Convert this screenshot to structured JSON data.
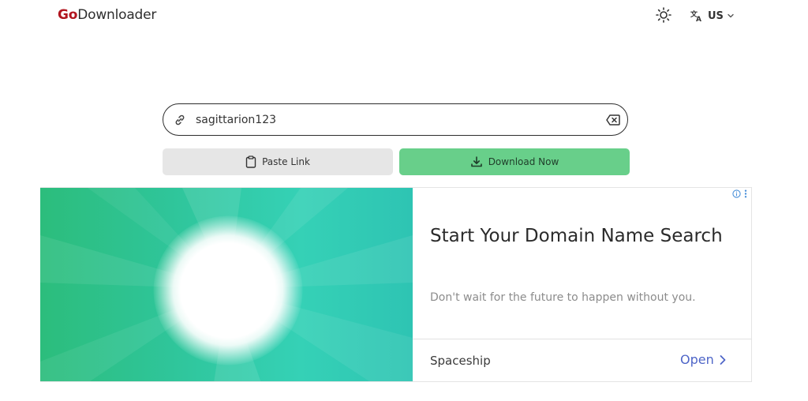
{
  "header": {
    "logo_go": "Go",
    "logo_rest": "Downloader",
    "language_code": "US",
    "icons": {
      "theme": "sun-icon",
      "language": "translate-icon",
      "dropdown": "chevron-down-icon"
    }
  },
  "search": {
    "value": "sagittarion123",
    "placeholder": "",
    "icons": {
      "left": "link-icon",
      "right": "backspace-clear-icon"
    }
  },
  "actions": {
    "paste_label": "Paste Link",
    "download_label": "Download Now"
  },
  "ad": {
    "headline": "Start Your Domain Name Search",
    "description": "Don't wait for the future to happen without you.",
    "advertiser": "Spaceship",
    "cta_label": "Open",
    "accent_color": "#4f66c8"
  },
  "colors": {
    "brand_red": "#b1151f",
    "download_green": "#68cf8a",
    "paste_gray": "#e6e6e6"
  }
}
